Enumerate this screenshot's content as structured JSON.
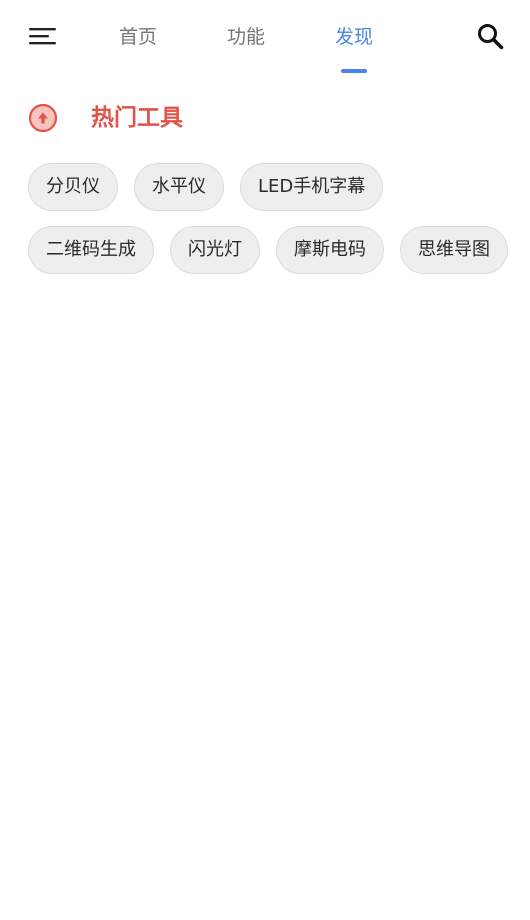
{
  "header": {
    "menu_icon": "hamburger-menu-icon",
    "tabs": [
      {
        "label": "首页",
        "active": false
      },
      {
        "label": "功能",
        "active": false
      },
      {
        "label": "发现",
        "active": true
      }
    ],
    "search_icon": "search-icon"
  },
  "section": {
    "icon": "arrow-up-circle-icon",
    "title": "热门工具"
  },
  "tools": [
    "分贝仪",
    "水平仪",
    "LED手机字幕",
    "二维码生成",
    "闪光灯",
    "摩斯电码",
    "思维导图"
  ],
  "colors": {
    "accent": "#4a86e8",
    "section_title": "#e35248",
    "chip_background": "#eeeeee",
    "tab_inactive": "#757575"
  }
}
